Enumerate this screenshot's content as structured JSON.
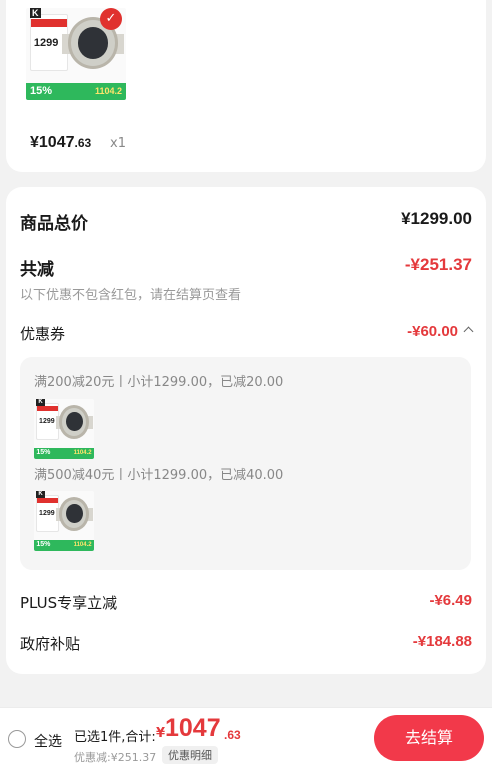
{
  "product": {
    "image_icon": "smartwatch-product-image",
    "thumb_brand": "K",
    "thumb_price": "1299",
    "thumb_badge": "15%",
    "thumb_promo": "1104.2",
    "price_int": "¥1047",
    "price_cents": ".63",
    "quantity": "x1"
  },
  "summary": {
    "total_label": "商品总价",
    "total_value": "¥1299.00",
    "reduce_label": "共减",
    "reduce_value": "-¥251.37",
    "note": "以下优惠不包含红包，请在结算页查看",
    "coupon_label": "优惠券",
    "coupon_value": "-¥60.00",
    "coupons": [
      {
        "text": "满200减20元丨小计1299.00，已减20.00"
      },
      {
        "text": "满500减40元丨小计1299.00，已减40.00"
      }
    ],
    "plus_label": "PLUS专享立减",
    "plus_value": "-¥6.49",
    "subsidy_label": "政府补贴",
    "subsidy_value": "-¥184.88"
  },
  "bottom": {
    "select_all": "全选",
    "selected_text": "已选1件,合计:",
    "total_prefix": "¥",
    "total_int": "1047",
    "total_cents": ".63",
    "discount_text": "优惠减:¥251.37",
    "detail_label": "优惠明细",
    "checkout_label": "去结算"
  },
  "colors": {
    "accent_red": "#e4393c",
    "button_red": "#f2394a",
    "badge_green": "#2eb85c"
  }
}
